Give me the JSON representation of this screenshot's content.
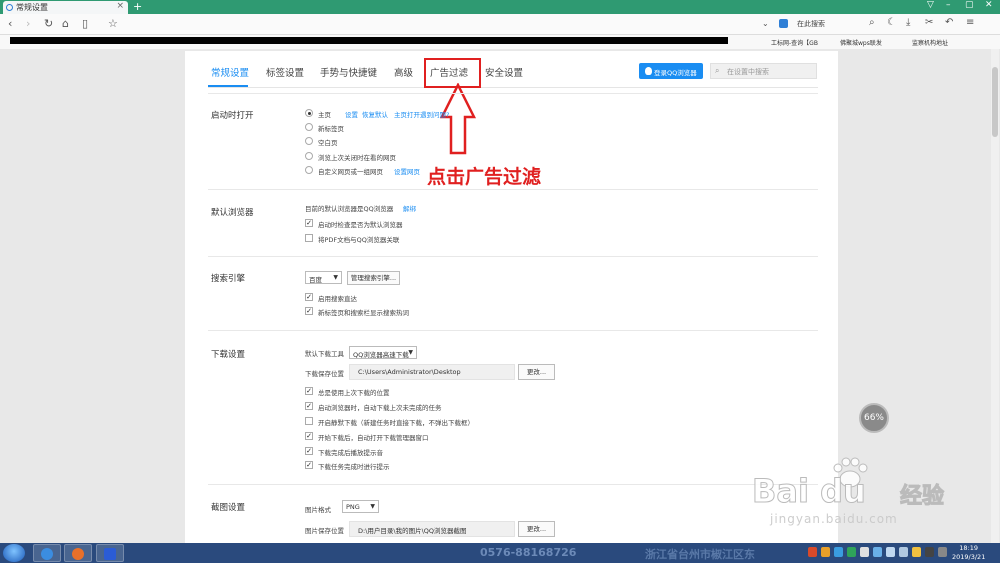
{
  "browser": {
    "tab_title": "常规设置",
    "new_tab_symbol": "+",
    "search_placeholder": "在此搜索",
    "bookmarks": [
      "工标网-查询【GB",
      "佛聚城wps联发",
      "监察机构地址"
    ],
    "window_controls": [
      "▢",
      "–",
      "▢",
      "✕"
    ]
  },
  "settings": {
    "nav_tabs": [
      "常规设置",
      "标签设置",
      "手势与快捷键",
      "高级",
      "广告过滤",
      "安全设置"
    ],
    "active_tab_index": 0,
    "highlighted_tab_index": 4,
    "login_button": "登录QQ浏览器",
    "search_placeholder": "在设置中搜索",
    "annotation_text": "点击广告过滤",
    "startup": {
      "title": "启动时打开",
      "options": [
        "主页",
        "新标签页",
        "空白页",
        "浏览上次关闭时在看的网页",
        "自定义网页或一组网页"
      ],
      "selected_index": 0,
      "home_links": [
        "设置",
        "恢复默认",
        "主页打开遇到问题?"
      ],
      "custom_link": "设置网页"
    },
    "default_browser": {
      "title": "默认浏览器",
      "status_text": "目前的默认浏览器是QQ浏览器",
      "unbind_link": "解绑",
      "checkboxes": [
        {
          "label": "启动时检查是否为默认浏览器",
          "checked": true
        },
        {
          "label": "将PDF文档与QQ浏览器关联",
          "checked": false
        }
      ]
    },
    "search_engine": {
      "title": "搜索引擎",
      "selected_engine": "百度",
      "manage_button": "管理搜索引擎...",
      "checkboxes": [
        {
          "label": "启用搜索直达",
          "checked": true
        },
        {
          "label": "新标签页和搜索栏显示搜索热词",
          "checked": true
        }
      ]
    },
    "download": {
      "title": "下载设置",
      "tool_label": "默认下载工具",
      "tool_value": "QQ浏览器高速下载",
      "path_label": "下载保存位置",
      "path_value": "C:\\Users\\Administrator\\Desktop",
      "change_button": "更改...",
      "checkboxes": [
        {
          "label": "总是使用上次下载的位置",
          "checked": true
        },
        {
          "label": "启动浏览器时，自动下载上次未完成的任务",
          "checked": true
        },
        {
          "label": "开启静默下载（新建任务时直接下载，不弹出下载框）",
          "checked": false
        },
        {
          "label": "开始下载后，自动打开下载管理器窗口",
          "checked": true
        },
        {
          "label": "下载完成后播放提示音",
          "checked": true
        },
        {
          "label": "下载任务完成时进行提示",
          "checked": true
        }
      ]
    },
    "screenshot": {
      "title": "截图设置",
      "format_label": "图片格式",
      "format_value": "PNG",
      "path_label": "图片保存位置",
      "path_value": "D:\\用户目录\\我的图片\\QQ浏览器截图",
      "change_button": "更改..."
    }
  },
  "overlay": {
    "speed_ball": "66%",
    "watermark_brand": "Bai du",
    "watermark_jingyan": "经验",
    "watermark_url": "jingyan.baidu.com"
  },
  "taskbar": {
    "banner_phone": "0576-88168726",
    "banner_text": "浙江省台州市椒江区东",
    "clock_time": "18:19",
    "clock_date": "2019/3/21"
  }
}
